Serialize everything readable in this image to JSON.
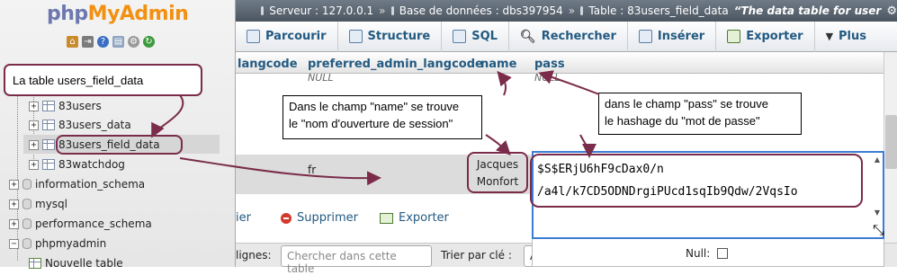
{
  "nav": {
    "logo_php": "php",
    "logo_myadmin": "MyAdmin",
    "items": [
      {
        "label": "83users"
      },
      {
        "label": "83users_data"
      },
      {
        "label": "83users_field_data"
      },
      {
        "label": "83watchdog"
      },
      {
        "label": "information_schema"
      },
      {
        "label": "mysql"
      },
      {
        "label": "performance_schema"
      },
      {
        "label": "phpmyadmin"
      },
      {
        "label": "Nouvelle table"
      }
    ]
  },
  "breadcrumb": {
    "server": "Serveur : 127.0.0.1",
    "database": "Base de données : dbs397954",
    "table": "Table : 83users_field_data",
    "comment": "“The data table for user"
  },
  "menu": {
    "tabs": [
      {
        "label": "Parcourir"
      },
      {
        "label": "Structure"
      },
      {
        "label": "SQL"
      },
      {
        "label": "Rechercher"
      },
      {
        "label": "Insérer"
      },
      {
        "label": "Exporter"
      },
      {
        "label": "Plus"
      }
    ]
  },
  "grid": {
    "columns": [
      "langcode",
      "preferred_admin_langcode",
      "name",
      "pass"
    ],
    "null_label": "NULL",
    "cell_langcode": "fr",
    "cell_name_line1": "Jacques",
    "cell_name_line2": "Monfort",
    "pass_line1": "$S$ERjU6hF9cDax0/n",
    "pass_line2": "/a4l/k7CD5ODNDrgiPUcd1sqIb9Qdw/2VqsIo",
    "null_checkbox_label": "Null:"
  },
  "actions": {
    "left_partial": "ier",
    "delete": "Supprimer",
    "export": "Exporter"
  },
  "bottom": {
    "rows_label_partial": "lignes:",
    "search_placeholder": "Chercher dans cette table",
    "sort_label": "Trier par clé :",
    "sort_value_partial": "A"
  },
  "annotations": {
    "table_note": "La table users_field_data",
    "name_note_line1": "Dans le champ \"name\" se trouve",
    "name_note_line2": "le \"nom d'ouverture de session\"",
    "pass_note_line1": "dans le champ \"pass\" se trouve",
    "pass_note_line2": "le hashage du \"mot de passe\""
  },
  "colors": {
    "accent": "#235a81",
    "annotation": "#7a2c4a",
    "logo_php": "#6c78af",
    "logo_myadmin": "#f29111"
  }
}
